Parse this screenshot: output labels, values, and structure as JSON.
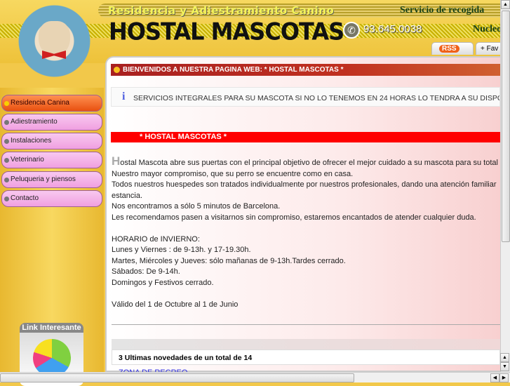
{
  "header": {
    "tagline": "Residencia y Adiestramiento Canino",
    "service": "Servicio de recogida",
    "nucleo": "Nucleo",
    "brand": "HOSTAL MASCOTAS",
    "phone": "93.645.0038",
    "tabs": {
      "rss": "RSS",
      "favorites": "+ Fav"
    }
  },
  "sidebar": {
    "items": [
      {
        "label": "Residencia Canina"
      },
      {
        "label": "Adiestramiento"
      },
      {
        "label": "Instalaciones"
      },
      {
        "label": "Veterinario"
      },
      {
        "label": "Peluqueria y piensos"
      },
      {
        "label": "Contacto"
      }
    ],
    "link_box": "Link Interesante"
  },
  "main": {
    "welcome": "BIENVENIDOS A NUESTRA PAGINA WEB: * HOSTAL MASCOTAS *",
    "info": "SERVICIOS INTEGRALES PARA SU MASCOTA SI NO LO TENEMOS EN 24 HORAS LO TENDRA A SU DISPOSICION",
    "section_title": "* HOSTAL MASCOTAS *",
    "first_letter": "H",
    "lines": [
      "ostal Mascota abre sus puertas con el principal objetivo de ofrecer el mejor cuidado a su mascota para su total",
      "Nuestro mayor compromiso, que su perro se encuentre como en casa.",
      "Todos nuestros huespedes son tratados individualmente por nuestros profesionales, dando una atención familiar",
      "estancia.",
      "Nos encontramos a sólo 5 minutos de Barcelona.",
      "Les recomendamos pasen a visitarnos sin compromiso, estaremos encantados de atender cualquier duda.",
      "",
      "HORARIO de INVIERNO:",
      "Lunes y Viernes : de 9-13h. y 17-19.30h.",
      "Martes, Miércoles y Jueves: sólo mañanas de 9-13h.Tardes cerrado.",
      "Sábados: De 9-14h.",
      "Domingos y Festivos cerrado.",
      "",
      "Válido del 1 de Octubre al 1 de Junio"
    ],
    "news_title": "3 Ultimas novedades de un total de 14",
    "news_link": "ZONA DE RECREO"
  }
}
